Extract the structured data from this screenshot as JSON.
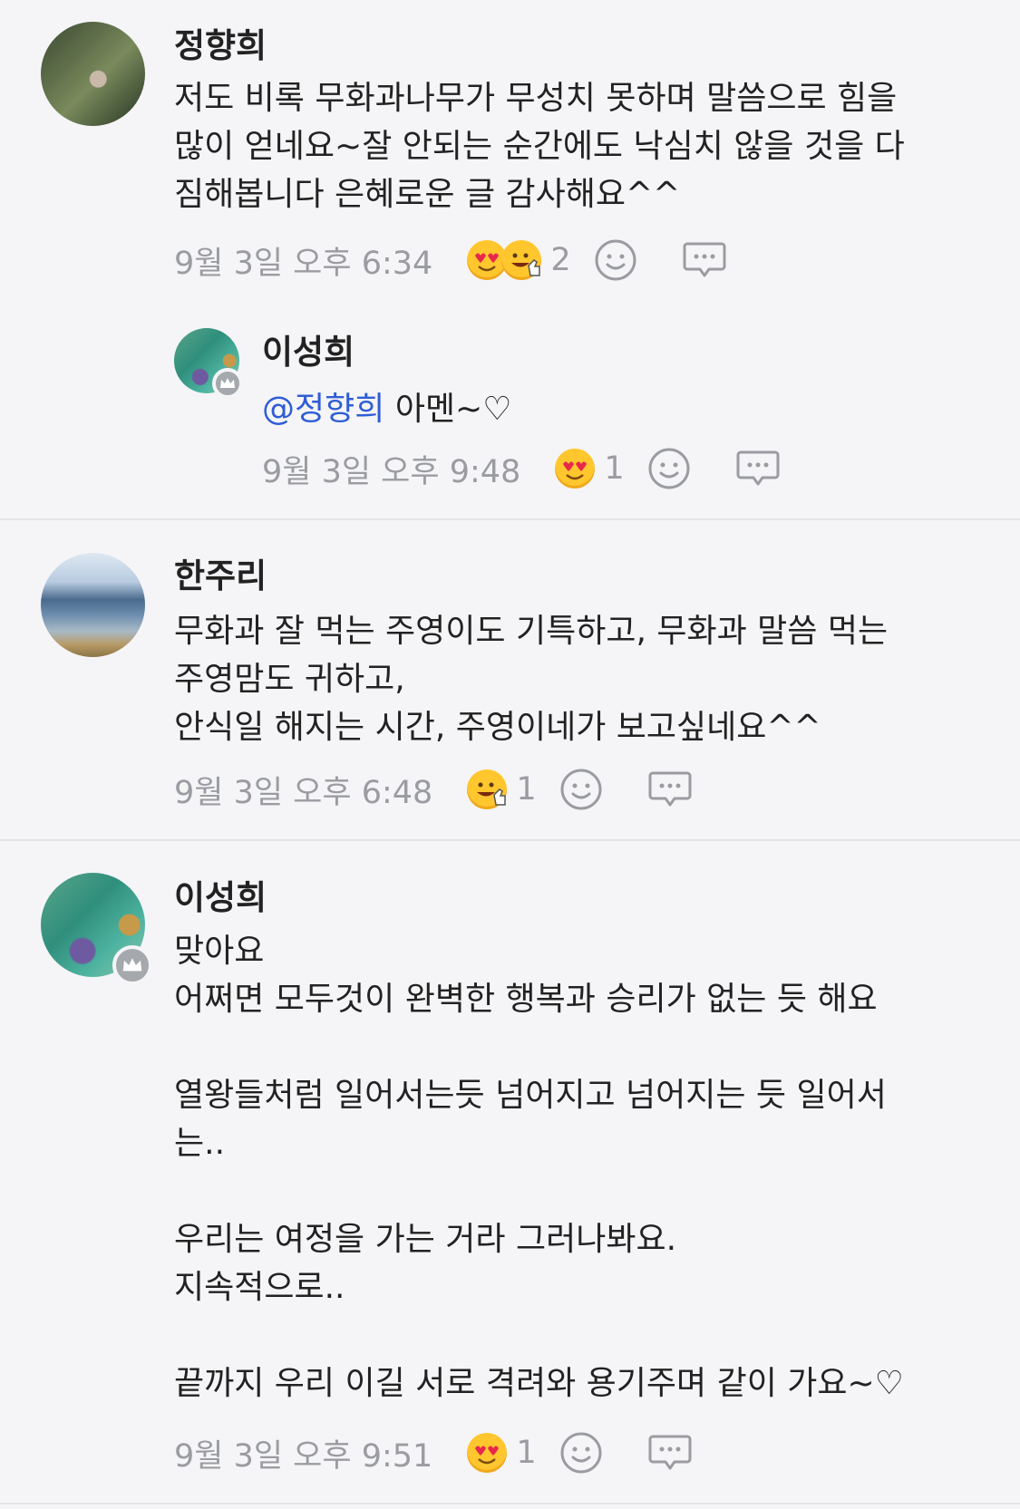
{
  "comments": [
    {
      "author": "정향희",
      "text": "저도 비록 무화과나무가 무성치 못하며 말씀으로 힘을\n많이 얻네요~잘 안되는 순간에도 낙심치 않을 것을 다\n짐해봅니다 은혜로운 글 감사해요^^",
      "time": "9월 3일 오후 6:34",
      "reactions": [
        "heart-eyes-emoji",
        "thumbs-up-smile-emoji"
      ],
      "reaction_count": "2"
    },
    {
      "author": "이성희",
      "mention": "@정향희",
      "text": " 아멘~♡",
      "time": "9월 3일 오후 9:48",
      "reactions": [
        "heart-eyes-emoji"
      ],
      "reaction_count": "1"
    },
    {
      "author": "한주리",
      "text": "무화과 잘 먹는 주영이도 기특하고, 무화과 말씀 먹는\n주영맘도 귀하고,\n안식일 해지는 시간, 주영이네가 보고싶네요^^",
      "time": "9월 3일 오후 6:48",
      "reactions": [
        "thumbs-up-smile-emoji"
      ],
      "reaction_count": "1"
    },
    {
      "author": "이성희",
      "text": "맞아요\n어쩌면 모두것이 완벽한 행복과 승리가 없는 듯 해요\n\n열왕들처럼 일어서는듯 넘어지고 넘어지는 듯 일어서\n는..\n\n우리는 여정을 가는 거라 그러나봐요.\n지속적으로..\n\n끝까지 우리 이길 서로 격려와 용기주며 같이 가요~♡",
      "time": "9월 3일 오후 9:51",
      "reactions": [
        "heart-eyes-emoji"
      ],
      "reaction_count": "1"
    }
  ],
  "icons": {
    "add_reaction": "smiley-add-icon",
    "reply": "speech-bubble-icon",
    "owner_badge": "crown-icon"
  },
  "colors": {
    "background": "#f5f5f7",
    "mention": "#2f5dd6",
    "meta_text": "#9a9ca1",
    "emoji_yellow": "#ffc62e"
  }
}
